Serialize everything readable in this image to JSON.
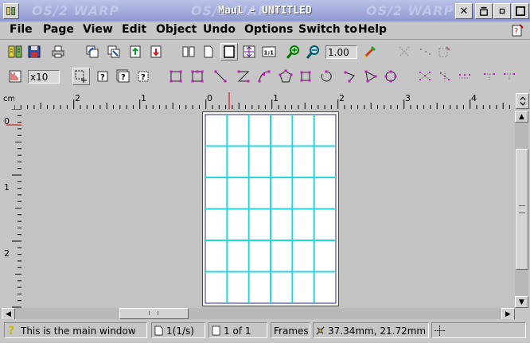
{
  "window": {
    "title": "Maul - UNTITLED",
    "watermark": "OS/2 WARP"
  },
  "menubar": [
    {
      "label": "File"
    },
    {
      "label": "Page"
    },
    {
      "label": "View"
    },
    {
      "label": "Edit"
    },
    {
      "label": "Object"
    },
    {
      "label": "Undo"
    },
    {
      "label": "Options"
    },
    {
      "label": "Switch to"
    },
    {
      "label": "Help"
    }
  ],
  "toolbar": {
    "zoom_value": "1.00",
    "grid_value": "x10"
  },
  "ruler": {
    "unit": "cm",
    "h_labels": [
      "2",
      "1",
      "0",
      "1",
      "2",
      "3",
      "4"
    ],
    "v_labels": [
      "0",
      "1",
      "2"
    ]
  },
  "statusbar": {
    "message": "This is the main window",
    "page_info": "1(1/s)",
    "page_count": "1 of 1",
    "mode": "Frames",
    "coords": "37.34mm, 21.72mm"
  },
  "colors": {
    "title_gradient_top": "#b9c2e8",
    "grid_line": "#25d5e0",
    "page_border": "#2a2a7a"
  }
}
